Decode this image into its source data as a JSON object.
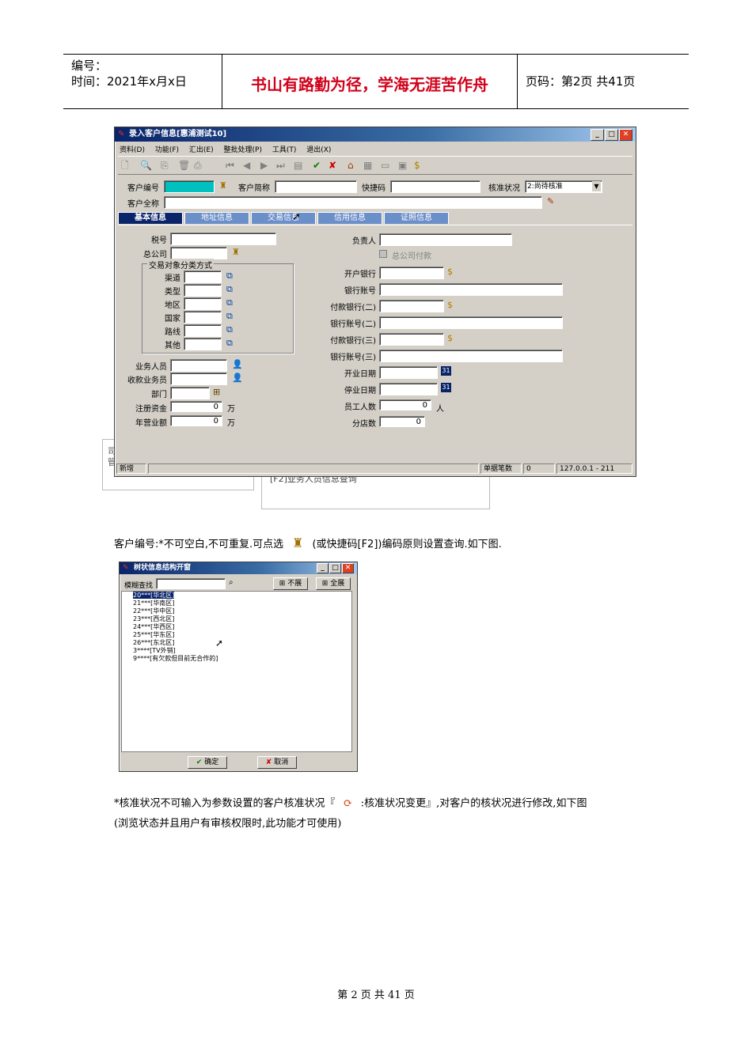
{
  "header": {
    "number_label": "编号：",
    "time_label": "时间：2021年x月x日",
    "motto": "书山有路勤为径，学海无涯苦作舟",
    "page_label": "页码：第2页 共41页"
  },
  "main_window": {
    "title": "录入客户信息[惠浦测试10]",
    "menu": [
      "资料(D)",
      "功能(F)",
      "汇出(E)",
      "整批处理(P)",
      "工具(T)",
      "退出(X)"
    ],
    "top": {
      "customer_code_label": "客户编号",
      "customer_short_label": "客户简称",
      "quick_code_label": "快捷码",
      "approval_label": "核准状况",
      "approval_value": "2:尚待核准",
      "customer_full_label": "客户全称"
    },
    "tabs": [
      "基本信息",
      "地址信息",
      "交易信息",
      "信用信息",
      "证照信息"
    ],
    "left": {
      "tax_label": "税号",
      "head_company_label": "总公司",
      "group_title": "交易对象分类方式",
      "group_items": [
        "渠道",
        "类型",
        "地区",
        "国家",
        "路线",
        "其他"
      ],
      "salesman_label": "业务人员",
      "collector_label": "收款业务员",
      "dept_label": "部门",
      "capital_label": "注册资金",
      "capital_value": "0",
      "capital_unit": "万",
      "revenue_label": "年营业额",
      "revenue_value": "0",
      "revenue_unit": "万"
    },
    "right": {
      "manager_label": "负责人",
      "head_pay_label": "总公司付款",
      "bank1_label": "开户银行",
      "account1_label": "银行账号",
      "bank2_label": "付款银行(二)",
      "account2_label": "银行账号(二)",
      "bank3_label": "付款银行(三)",
      "account3_label": "银行账号(三)",
      "open_date_label": "开业日期",
      "close_date_label": "停业日期",
      "staff_label": "员工人数",
      "staff_value": "0",
      "staff_unit": "人",
      "branch_label": "分店数",
      "branch_value": "0"
    },
    "status": {
      "mode": "新增",
      "count_label": "单据笔数",
      "count_value": "0",
      "server": "127.0.0.1 - 211"
    }
  },
  "behind_text": {
    "left_chars": "司\n管",
    "bottom": "[F2]业务人员信息查询"
  },
  "paragraph1": "客户编号:*不可空白,不可重复.可点选",
  "paragraph1b": "(或快捷码[F2])编码原则设置查询.如下图.",
  "tree_window": {
    "title": "树状信息结构开窗",
    "search_label": "模糊查找",
    "collapse_label": "不展",
    "expand_label": "全展",
    "items": [
      "20***[华北区]",
      "21***[华南区]",
      "22***[华中区]",
      "23***[西北区]",
      "24***[华西区]",
      "25***[华东区]",
      "26***[东北区]",
      "3****[TV外销]",
      "9****[有欠款但目前无合作的]"
    ],
    "ok_label": "确定",
    "cancel_label": "取消"
  },
  "paragraph2a": "*核准状况不可输入为参数设置的客户核准状况『",
  "paragraph2b": ":核准状况变更』,对客户的核状况进行修改,如下图",
  "paragraph3": "(浏览状态并且用户有审核权限时,此功能才可使用)",
  "footer": "第 2 页 共 41 页",
  "colors": {
    "motto": "#d0021b",
    "title_bar": "#0a246a",
    "code_field": "#00c0c0"
  }
}
